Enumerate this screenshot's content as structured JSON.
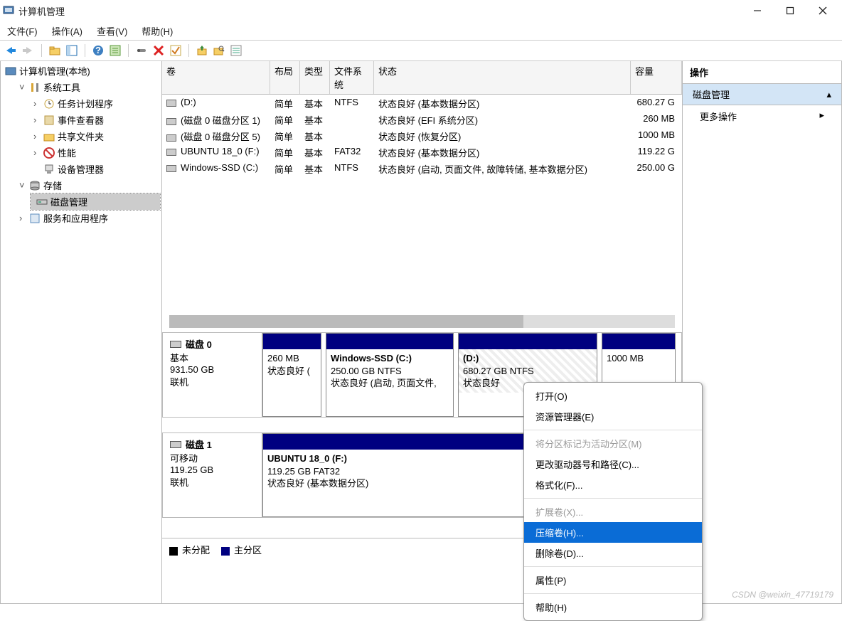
{
  "window": {
    "title": "计算机管理"
  },
  "menubar": {
    "file": "文件(F)",
    "action": "操作(A)",
    "view": "查看(V)",
    "help": "帮助(H)"
  },
  "tree": {
    "root": "计算机管理(本地)",
    "system_tools": "系统工具",
    "task_scheduler": "任务计划程序",
    "event_viewer": "事件查看器",
    "shared_folders": "共享文件夹",
    "performance": "性能",
    "device_manager": "设备管理器",
    "storage": "存储",
    "disk_management": "磁盘管理",
    "services_apps": "服务和应用程序"
  },
  "columns": {
    "volume": "卷",
    "layout": "布局",
    "type": "类型",
    "fs": "文件系统",
    "status": "状态",
    "capacity": "容量"
  },
  "volumes": [
    {
      "name": "(D:)",
      "layout": "简单",
      "type": "基本",
      "fs": "NTFS",
      "status": "状态良好 (基本数据分区)",
      "cap": "680.27 G"
    },
    {
      "name": "(磁盘 0 磁盘分区 1)",
      "layout": "简单",
      "type": "基本",
      "fs": "",
      "status": "状态良好 (EFI 系统分区)",
      "cap": "260 MB"
    },
    {
      "name": "(磁盘 0 磁盘分区 5)",
      "layout": "简单",
      "type": "基本",
      "fs": "",
      "status": "状态良好 (恢复分区)",
      "cap": "1000 MB"
    },
    {
      "name": "UBUNTU 18_0 (F:)",
      "layout": "简单",
      "type": "基本",
      "fs": "FAT32",
      "status": "状态良好 (基本数据分区)",
      "cap": "119.22 G"
    },
    {
      "name": "Windows-SSD (C:)",
      "layout": "简单",
      "type": "基本",
      "fs": "NTFS",
      "status": "状态良好 (启动, 页面文件, 故障转储, 基本数据分区)",
      "cap": "250.00 G"
    }
  ],
  "disk0": {
    "label": "磁盘 0",
    "kind": "基本",
    "size": "931.50 GB",
    "state": "联机",
    "p1": {
      "title": "",
      "size": "260 MB",
      "status": "状态良好 ("
    },
    "p2": {
      "title": "Windows-SSD  (C:)",
      "line2": "250.00 GB NTFS",
      "status": "状态良好 (启动, 页面文件,"
    },
    "p3": {
      "title": "(D:)",
      "line2": "680.27 GB NTFS",
      "status": "状态良好"
    },
    "p4": {
      "title": "",
      "size": "1000 MB",
      "status": ""
    }
  },
  "disk1": {
    "label": "磁盘 1",
    "kind": "可移动",
    "size": "119.25 GB",
    "state": "联机",
    "p1": {
      "title": "UBUNTU 18_0  (F:)",
      "line2": "119.25 GB FAT32",
      "status": "状态良好 (基本数据分区)"
    }
  },
  "legend": {
    "unallocated": "未分配",
    "primary": "主分区"
  },
  "actions_panel": {
    "title": "操作",
    "subtitle": "磁盘管理",
    "more": "更多操作"
  },
  "context_menu": {
    "open": "打开(O)",
    "explorer": "资源管理器(E)",
    "mark_active": "将分区标记为活动分区(M)",
    "change_letter": "更改驱动器号和路径(C)...",
    "format": "格式化(F)...",
    "extend": "扩展卷(X)...",
    "shrink": "压缩卷(H)...",
    "delete": "删除卷(D)...",
    "properties": "属性(P)",
    "help": "帮助(H)"
  },
  "watermark": "CSDN @weixin_47719179"
}
